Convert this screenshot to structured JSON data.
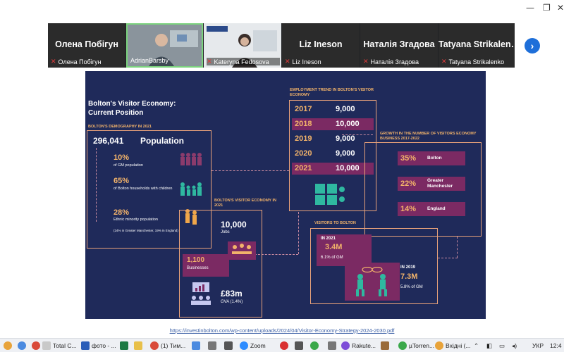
{
  "participants": [
    {
      "name_big": "Олена Побігун",
      "label": "Олена Побігун"
    },
    {
      "label": "AdrianBarsby"
    },
    {
      "label": "Kateryna Fedosova"
    },
    {
      "name_big": "Liz Ineson",
      "label": "Liz Ineson"
    },
    {
      "name_big": "Наталія Згадова",
      "label": "Наталія Згадова"
    },
    {
      "name_big": "Tatyana  Strikalen…",
      "label": "Tatyana Strikalenko"
    }
  ],
  "slide": {
    "title": "Bolton's Visitor Economy:",
    "subtitle": "Current Position",
    "demography": {
      "header": "BOLTON'S DEMOGRAPHY IN 2021",
      "population_value": "296,041",
      "population_label": "Population",
      "stats": [
        {
          "value": "10%",
          "label": "of GM population"
        },
        {
          "value": "65%",
          "label": "of Bolton households with children"
        },
        {
          "value": "28%",
          "label": "Ethnic minority population",
          "note": "(24% in Greater Manchester, 19% in England)"
        }
      ]
    },
    "employment": {
      "header": "EMPLOYMENT TREND IN BOLTON'S VISITOR ECONOMY",
      "rows": [
        {
          "year": "2017",
          "value": "9,000",
          "highlight": false
        },
        {
          "year": "2018",
          "value": "10,000",
          "highlight": true
        },
        {
          "year": "2019",
          "value": "9,000",
          "highlight": false
        },
        {
          "year": "2020",
          "value": "9,000",
          "highlight": false
        },
        {
          "year": "2021",
          "value": "10,000",
          "highlight": true
        }
      ]
    },
    "growth": {
      "header": "GROWTH IN THE NUMBER OF VISITORS ECONOMY BUSINESS 2017-2022",
      "rows": [
        {
          "value": "35%",
          "label": "Bolton"
        },
        {
          "value": "22%",
          "label": "Greater Manchester"
        },
        {
          "value": "14%",
          "label": "England"
        }
      ]
    },
    "visitor_economy": {
      "header": "BOLTON'S VISITOR ECONOMY IN 2021",
      "jobs_value": "10,000",
      "jobs_label": "Jobs",
      "business_value": "1,100",
      "business_label": "Businesses",
      "gva_value": "£83m",
      "gva_label": "GVA (1.4%)"
    },
    "visitors": {
      "header": "VISITORS TO BOLTON",
      "y2021_label": "IN 2021",
      "y2021_value": "3.4M",
      "y2021_sub": "6.1% of GM",
      "y2019_label": "IN 2019",
      "y2019_value": "7.3M",
      "y2019_sub": "5.8% of GM"
    }
  },
  "source_link": "https://investinbolton.com/wp-content/uploads/2024/04/Visitor-Economy-Strategy-2024-2030.pdf",
  "taskbar": {
    "items": [
      "Total C...",
      "фото - ...",
      "(1) Тим...",
      "Zoom",
      "Rakute...",
      "µTorren...",
      "Вхідні (..."
    ],
    "lang": "УКР",
    "time": "12:4"
  },
  "colors": {
    "slide_bg": "#1f2a5a",
    "accent_orange": "#f2b36a",
    "box_purple": "#7b2a63",
    "border": "#e9a27a",
    "teal": "#2fb8a0"
  }
}
